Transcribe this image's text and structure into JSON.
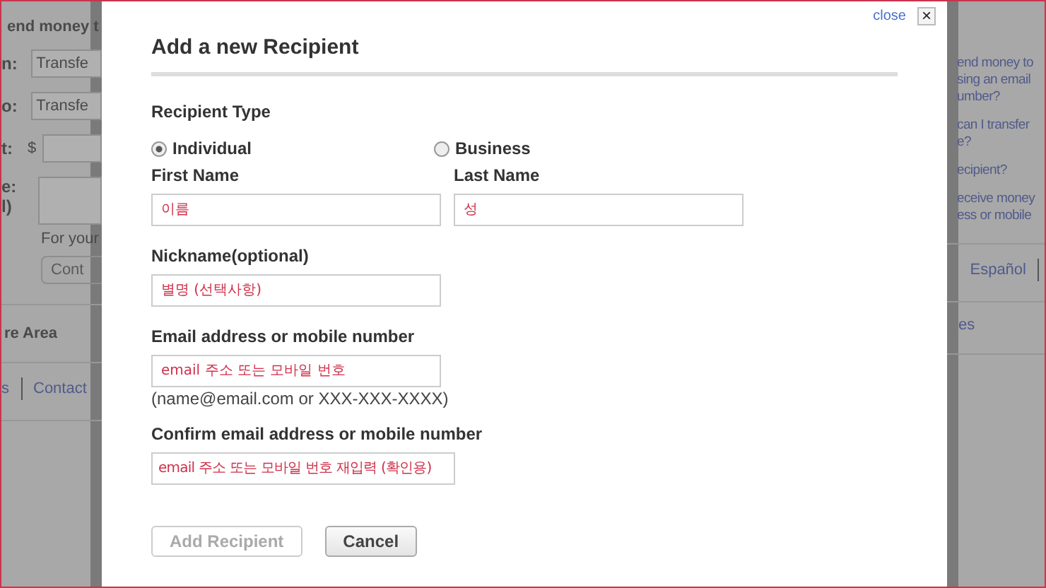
{
  "background_left": {
    "heading": "end money t",
    "rows": [
      {
        "label": "n:",
        "field_value": "Transfe"
      },
      {
        "label": "o:",
        "field_value": "Transfe"
      }
    ],
    "amount_label": "t:",
    "currency": "$",
    "message_label": [
      "e:",
      "l)"
    ],
    "hint": "For your",
    "button": "Cont",
    "section": "re Area",
    "links": [
      "s",
      "Contact"
    ]
  },
  "background_right": {
    "links": [
      "end money to",
      "sing an email",
      "umber?",
      "can I transfer",
      "e?",
      "ecipient?",
      "eceive money",
      "ess or mobile"
    ],
    "language_link": "Español",
    "bottom_link": "es"
  },
  "dialog": {
    "close_link": "close",
    "close_icon": "×",
    "title": "Add a new Recipient",
    "type_label": "Recipient Type",
    "types": [
      {
        "label": "Individual",
        "selected": true
      },
      {
        "label": "Business",
        "selected": false
      }
    ],
    "first_name": {
      "label": "First Name",
      "placeholder": "이름"
    },
    "last_name": {
      "label": "Last Name",
      "placeholder": "성"
    },
    "nickname": {
      "label": "Nickname(optional)",
      "placeholder": "별명 (선택사항)"
    },
    "email": {
      "label": "Email address or mobile number",
      "placeholder": "email 주소 또는 모바일 번호",
      "hint": "(name@email.com or XXX-XXX-XXXX)"
    },
    "confirm_email": {
      "label": "Confirm email address or mobile number",
      "placeholder": "email 주소 또는 모바일 번호 재입력 (확인용)"
    },
    "buttons": [
      {
        "label": "Add Recipient",
        "disabled": true
      },
      {
        "label": "Cancel",
        "disabled": false
      }
    ]
  }
}
